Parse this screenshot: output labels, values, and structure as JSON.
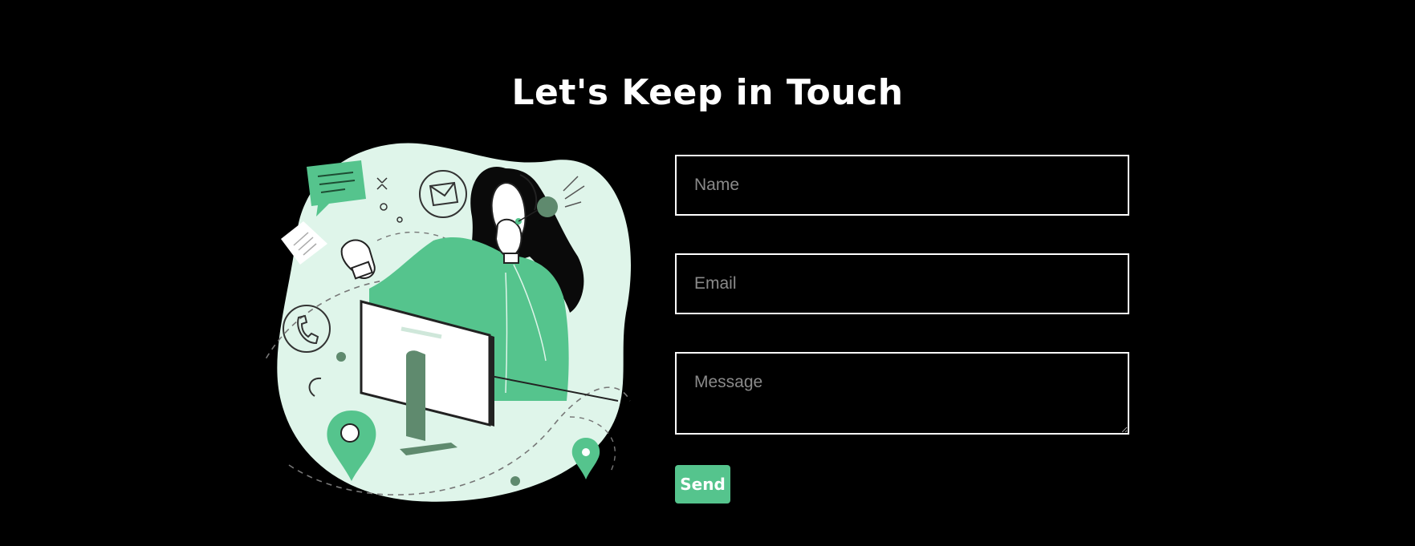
{
  "page": {
    "title": "Let's Keep in Touch"
  },
  "form": {
    "name_placeholder": "Name",
    "email_placeholder": "Email",
    "message_placeholder": "Message",
    "send_label": "Send"
  },
  "colors": {
    "background": "#000000",
    "accent": "#55c48d",
    "accent_light": "#dff5ea",
    "accent_dark": "#5f8a6e",
    "text": "#ffffff",
    "placeholder": "#8a8a8a"
  },
  "illustration": {
    "subject": "customer-support-agent",
    "icons": [
      "chat-bubble-icon",
      "mail-icon",
      "phone-icon",
      "location-pin-icon",
      "monitor-icon",
      "headset-icon",
      "note-icon"
    ]
  }
}
